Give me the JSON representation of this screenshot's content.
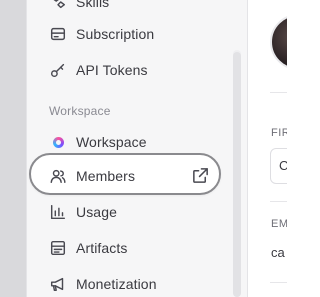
{
  "sidebar": {
    "items_top": [
      {
        "label": "Skills",
        "icon": "skills-icon"
      },
      {
        "label": "Subscription",
        "icon": "credit-card-icon"
      },
      {
        "label": "API Tokens",
        "icon": "key-icon"
      }
    ],
    "section_label": "Workspace",
    "items_workspace": [
      {
        "label": "Workspace",
        "icon": "workspace-logo-icon"
      },
      {
        "label": "Members",
        "icon": "users-icon",
        "external_icon": "external-link-icon"
      },
      {
        "label": "Usage",
        "icon": "bar-chart-icon"
      },
      {
        "label": "Artifacts",
        "icon": "artifact-icon"
      },
      {
        "label": "Monetization",
        "icon": "megaphone-icon"
      }
    ]
  },
  "main": {
    "first_field_label": "FIR",
    "first_field_value": "C",
    "second_field_label": "EM",
    "second_field_value": "ca"
  },
  "colors": {
    "sidebar_bg": "#f6f6f7",
    "highlight_border": "#8a8a8e",
    "text": "#3a3a40",
    "muted": "#8a8a92"
  }
}
